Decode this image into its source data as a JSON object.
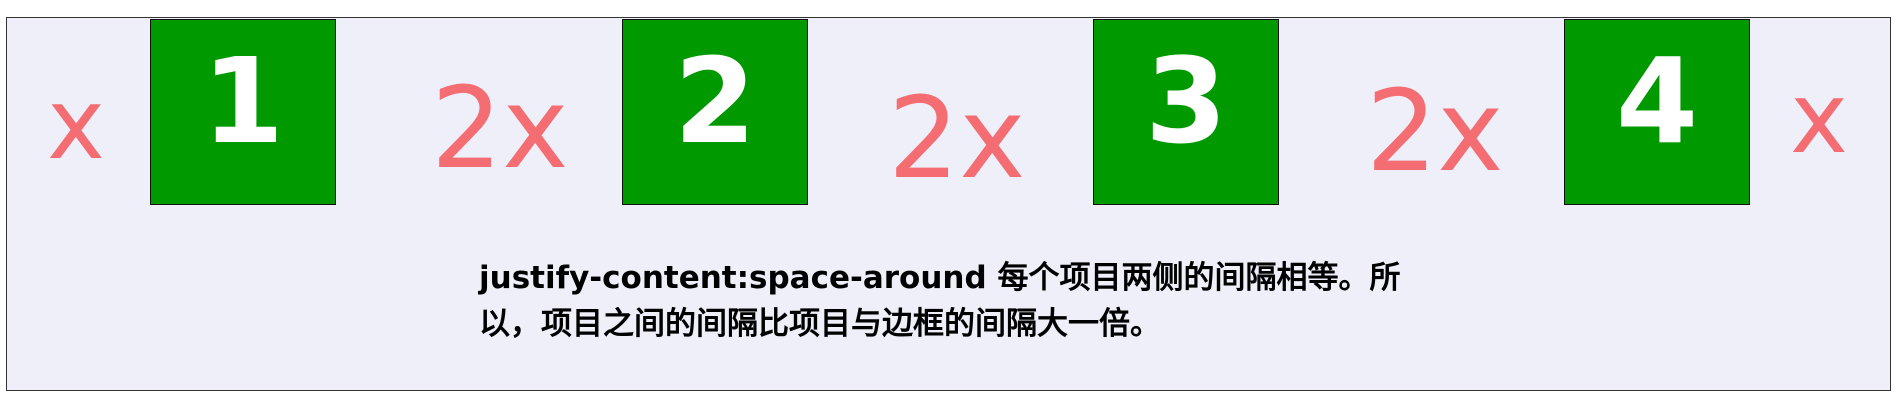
{
  "items": [
    {
      "label": "1"
    },
    {
      "label": "2"
    },
    {
      "label": "3"
    },
    {
      "label": "4"
    }
  ],
  "gaps": [
    {
      "label": "x"
    },
    {
      "label": "2x"
    },
    {
      "label": "2x"
    },
    {
      "label": "2x"
    },
    {
      "label": "x"
    }
  ],
  "caption": "justify-content:space-around 每个项目两侧的间隔相等。所以，项目之间的间隔比项目与边框的间隔大一倍。",
  "colors": {
    "item_background": "#009900",
    "item_text": "#ffffff",
    "gap_text": "#f46d72",
    "container_background": "#efeffa"
  }
}
